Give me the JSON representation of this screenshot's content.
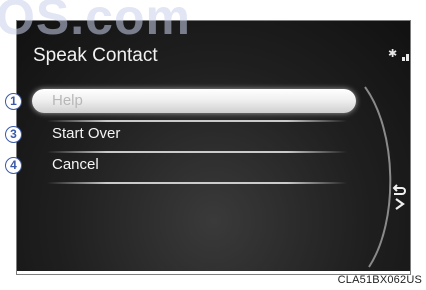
{
  "screen": {
    "title": "Speak Contact",
    "status_icons": [
      "bluetooth-icon",
      "signal-icon",
      "battery-icon"
    ],
    "bluetooth_glyph": "✱"
  },
  "menu": {
    "items": [
      {
        "label": "Help",
        "callout": "1",
        "highlighted": true
      },
      {
        "label": "Start Over",
        "callout": "3",
        "highlighted": false
      },
      {
        "label": "Cancel",
        "callout": "4",
        "highlighted": false
      }
    ]
  },
  "watermark": "OS.com",
  "caption": "CLA51BX062US",
  "colors": {
    "screen_bg": "#1f1f1f",
    "text": "#f4f4f4",
    "callout": "#3b5aa8"
  }
}
